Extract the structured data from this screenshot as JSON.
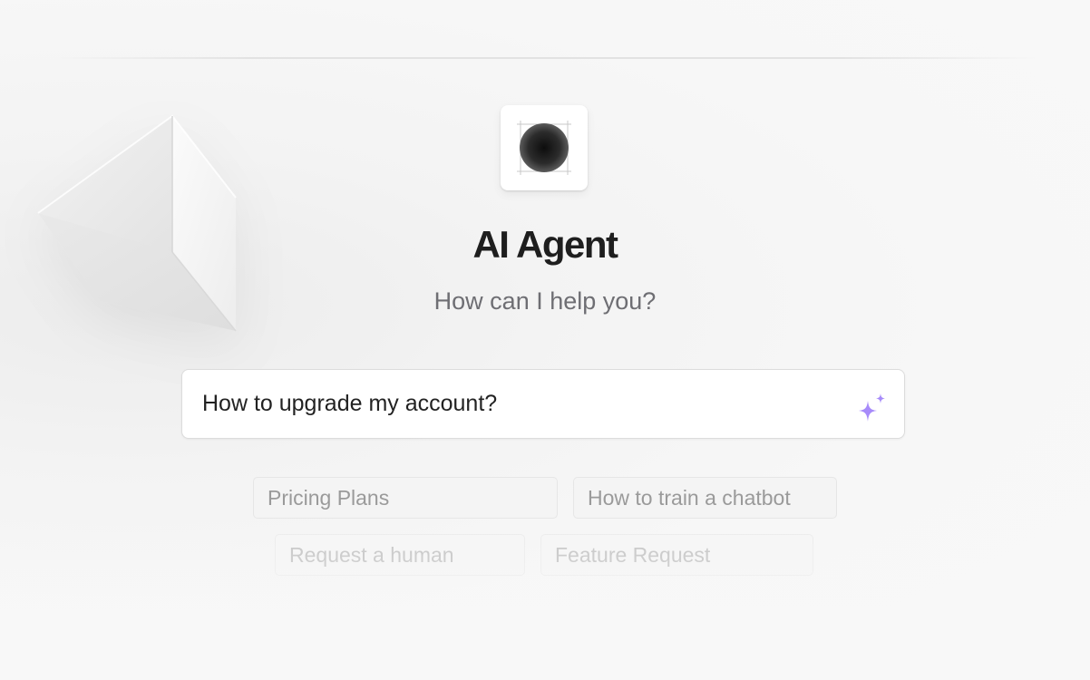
{
  "header": {
    "title": "AI Agent",
    "subtitle": "How can I help you?"
  },
  "logo": {
    "icon": "sphere-logo-icon"
  },
  "search": {
    "value": "How to upgrade my account?",
    "submit_icon": "sparkle-icon",
    "accent_color": "#a78bfa"
  },
  "suggestions": [
    {
      "label": "Pricing Plans"
    },
    {
      "label": "How to train a chatbot"
    },
    {
      "label": "Request a human"
    },
    {
      "label": "Feature Request"
    }
  ],
  "decoration": {
    "shape": "prism-3d-shape"
  }
}
